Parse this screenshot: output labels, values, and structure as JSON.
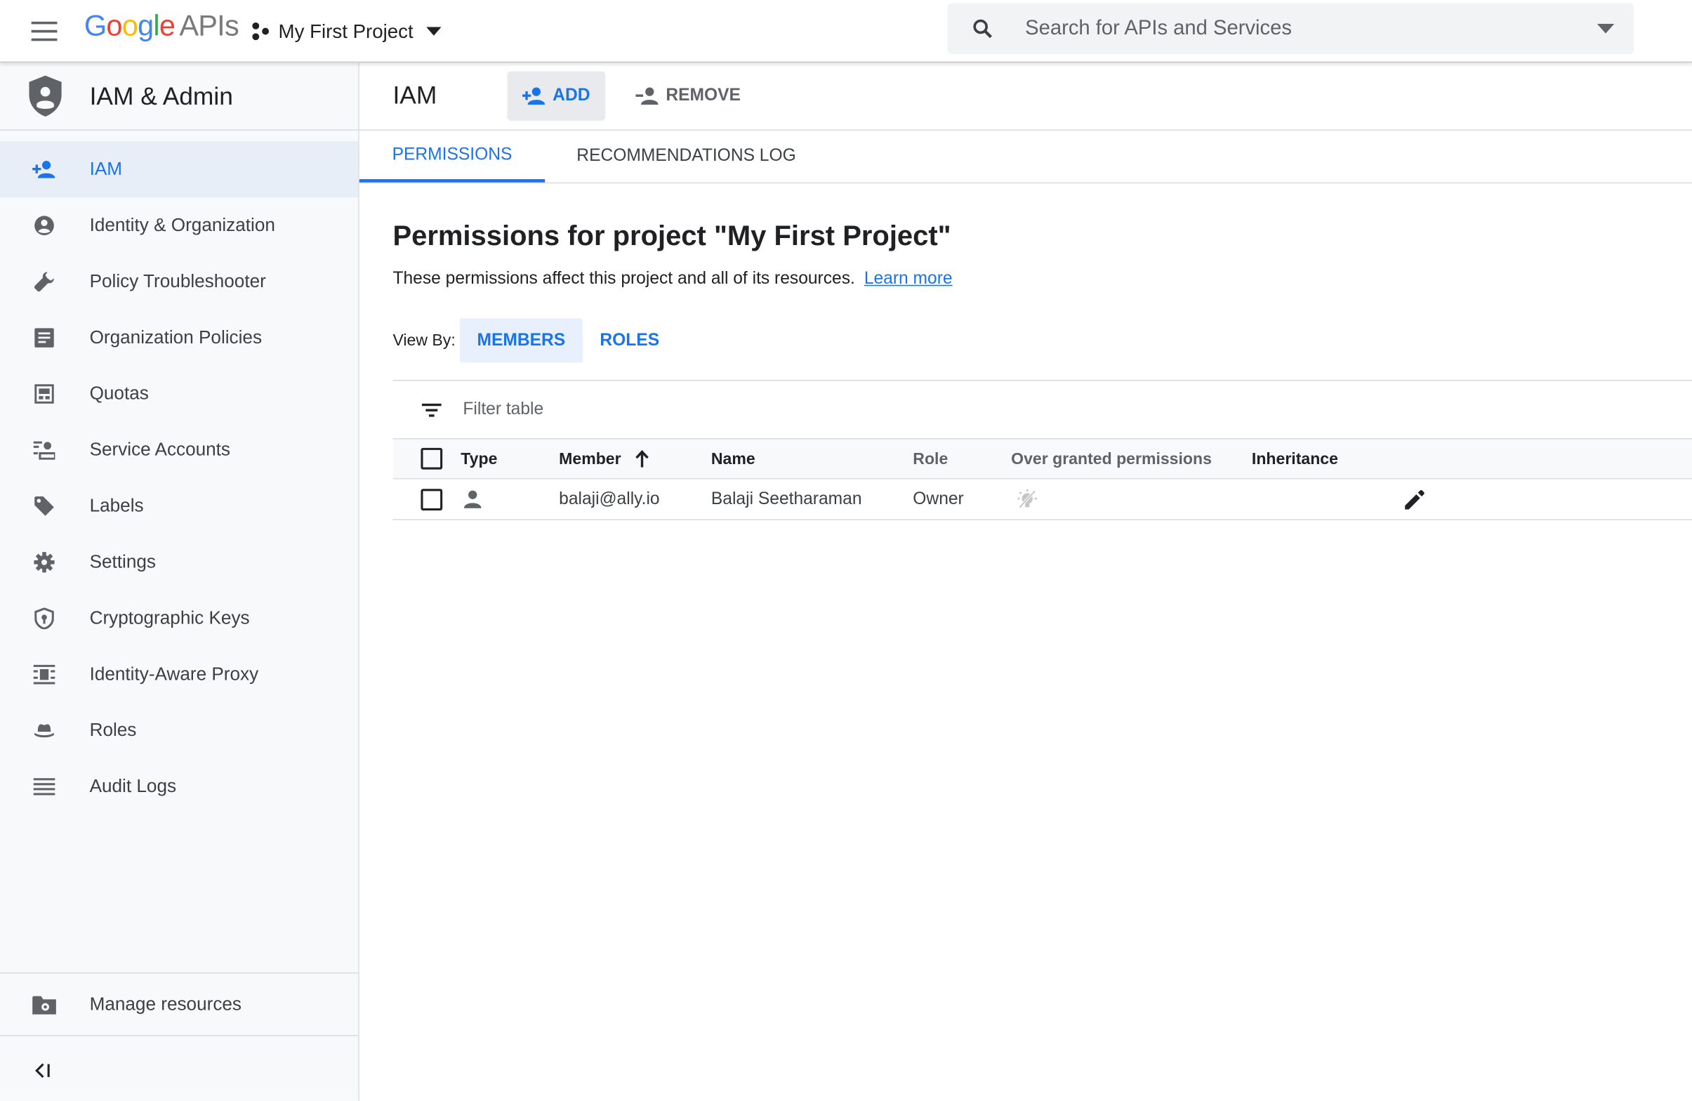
{
  "topbar": {
    "logo_google": [
      "G",
      "o",
      "o",
      "g",
      "l",
      "e"
    ],
    "logo_apis": "APIs",
    "project_name": "My First Project",
    "search_placeholder": "Search for APIs and Services"
  },
  "sidebar": {
    "title": "IAM & Admin",
    "items": [
      {
        "label": "IAM",
        "icon": "person-add-icon",
        "active": true
      },
      {
        "label": "Identity & Organization",
        "icon": "account-circle-icon"
      },
      {
        "label": "Policy Troubleshooter",
        "icon": "wrench-icon"
      },
      {
        "label": "Organization Policies",
        "icon": "document-icon"
      },
      {
        "label": "Quotas",
        "icon": "quotas-icon"
      },
      {
        "label": "Service Accounts",
        "icon": "service-account-icon"
      },
      {
        "label": "Labels",
        "icon": "label-icon"
      },
      {
        "label": "Settings",
        "icon": "gear-icon"
      },
      {
        "label": "Cryptographic Keys",
        "icon": "security-shield-icon"
      },
      {
        "label": "Identity-Aware Proxy",
        "icon": "proxy-icon"
      },
      {
        "label": "Roles",
        "icon": "hat-icon"
      },
      {
        "label": "Audit Logs",
        "icon": "list-icon"
      }
    ],
    "manage_resources": "Manage resources"
  },
  "main": {
    "page_title": "IAM",
    "add_label": "ADD",
    "remove_label": "REMOVE",
    "tabs": [
      "PERMISSIONS",
      "RECOMMENDATIONS LOG"
    ],
    "heading": "Permissions for project \"My First Project\"",
    "description": "These permissions affect this project and all of its resources.",
    "learn_more": "Learn more",
    "view_by_label": "View By:",
    "view_by_options": [
      "MEMBERS",
      "ROLES"
    ],
    "filter_placeholder": "Filter table",
    "table": {
      "columns": [
        "Type",
        "Member",
        "Name",
        "Role",
        "Over granted permissions",
        "Inheritance"
      ],
      "rows": [
        {
          "type_icon": "person-icon",
          "member": "balaji@ally.io",
          "name": "Balaji Seetharaman",
          "role": "Owner"
        }
      ]
    }
  },
  "colors": {
    "accent": "#1a73e8",
    "sidebar_bg": "#f8f9fa",
    "active_bg": "#e8eef8"
  }
}
